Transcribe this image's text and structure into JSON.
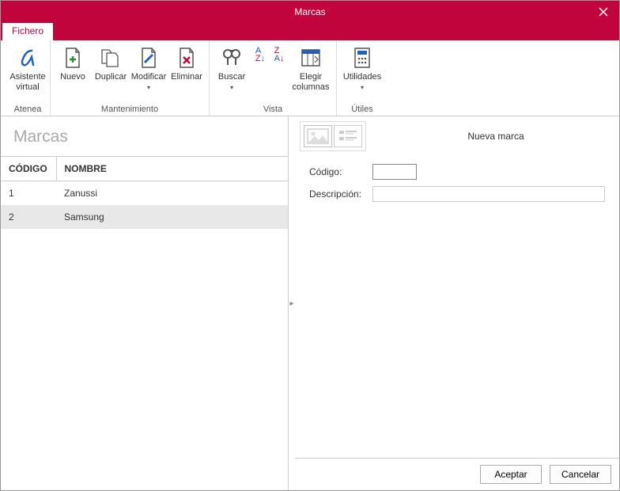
{
  "window": {
    "title": "Marcas"
  },
  "tabs": {
    "fichero": "Fichero"
  },
  "ribbon": {
    "atenea": {
      "label": "Asistente\nvirtual",
      "group": "Atenea"
    },
    "nuevo": "Nuevo",
    "duplicar": "Duplicar",
    "modificar": "Modificar",
    "eliminar": "Eliminar",
    "mantenimiento": "Mantenimiento",
    "buscar": "Buscar",
    "elegir": "Elegir\ncolumnas",
    "vista": "Vista",
    "utilidades": "Utilidades",
    "utiles": "Útiles"
  },
  "list": {
    "heading": "Marcas",
    "cols": {
      "codigo": "CÓDIGO",
      "nombre": "NOMBRE"
    },
    "rows": [
      {
        "codigo": "1",
        "nombre": "Zanussi"
      },
      {
        "codigo": "2",
        "nombre": "Samsung"
      }
    ]
  },
  "detail": {
    "title": "Nueva marca",
    "codigo_label": "Código:",
    "desc_label": "Descripción:",
    "codigo_value": "",
    "desc_value": ""
  },
  "buttons": {
    "accept": "Aceptar",
    "cancel": "Cancelar"
  }
}
